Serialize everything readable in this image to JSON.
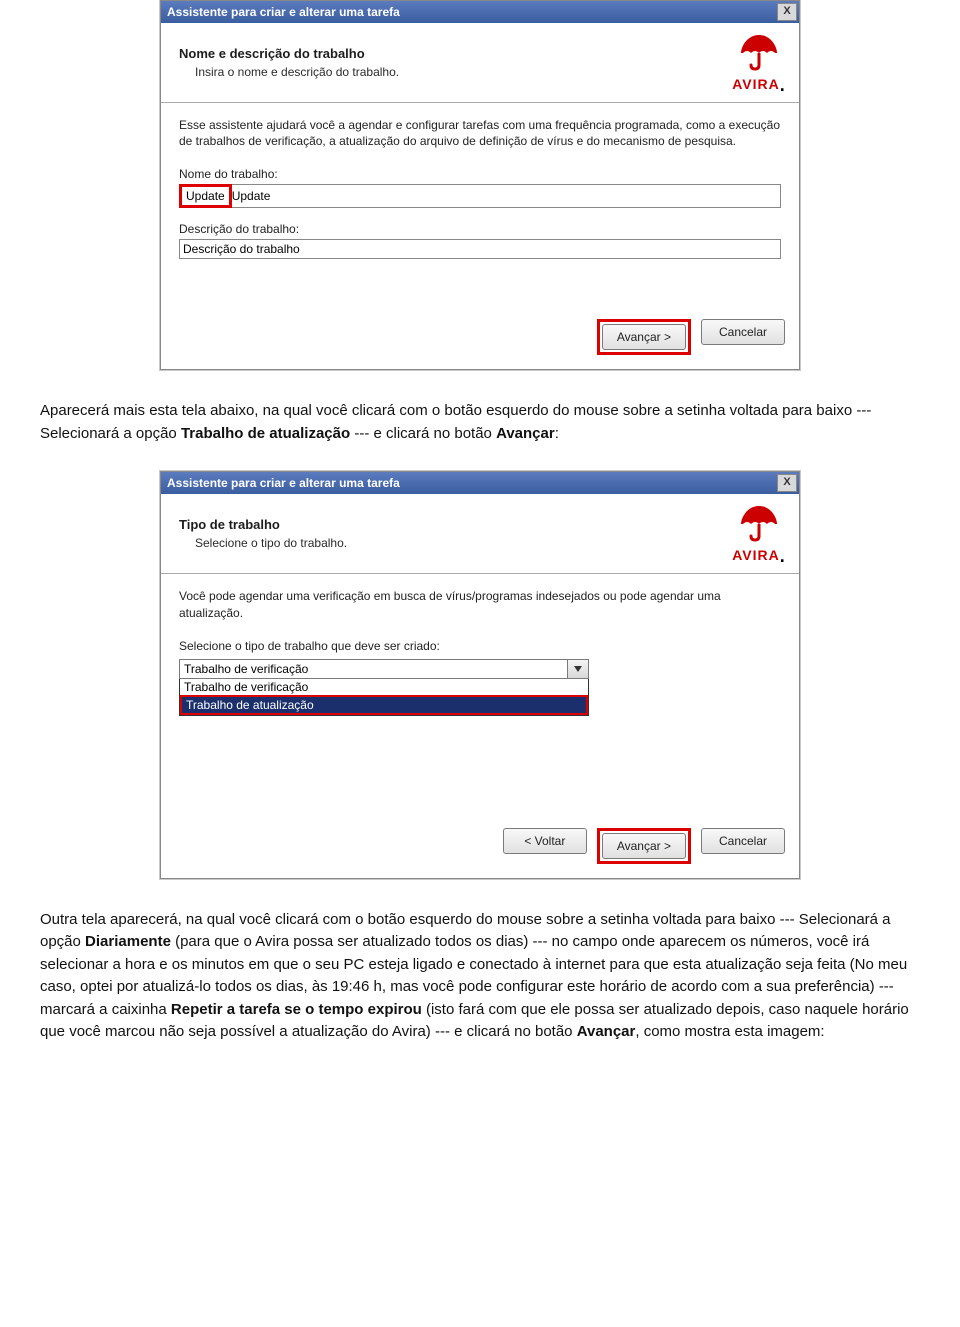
{
  "dialog1": {
    "title": "Assistente para criar e alterar uma tarefa",
    "headerTitle": "Nome e descrição do trabalho",
    "headerSub": "Insira o nome e descrição do trabalho.",
    "brand": "AVIRA",
    "intro": "Esse assistente ajudará você a agendar e configurar tarefas com uma frequência programada, como a execução de trabalhos de verificação, a atualização do arquivo de definição de vírus e do mecanismo de pesquisa.",
    "nameLabel": "Nome do trabalho:",
    "nameValue": "Update",
    "descLabel": "Descrição do trabalho:",
    "descValue": "Descrição do trabalho",
    "advance": "Avançar >",
    "cancel": "Cancelar",
    "closeX": "X"
  },
  "para1": {
    "t0": "Aparecerá mais esta tela abaixo, na qual você clicará com o botão esquerdo do mouse sobre a setinha voltada para baixo --- Selecionará a opção ",
    "b1": "Trabalho de atualização",
    "t2": " --- e clicará no botão ",
    "b3": "Avançar",
    "t4": ":"
  },
  "dialog2": {
    "title": "Assistente para criar e alterar uma tarefa",
    "headerTitle": "Tipo de trabalho",
    "headerSub": "Selecione o tipo do trabalho.",
    "brand": "AVIRA",
    "intro": "Você pode agendar uma verificação em busca de vírus/programas indesejados ou pode agendar uma atualização.",
    "selectLabel": "Selecione o tipo de trabalho que deve ser criado:",
    "comboValue": "Trabalho de verificação",
    "opt1": "Trabalho de verificação",
    "opt2": "Trabalho de atualização",
    "back": "< Voltar",
    "advance": "Avançar >",
    "cancel": "Cancelar",
    "closeX": "X"
  },
  "para2": {
    "t0": "Outra tela aparecerá, na qual você clicará com o botão esquerdo do mouse sobre a setinha voltada para baixo --- Selecionará a opção ",
    "b1": "Diariamente",
    "t2": " (para que o Avira possa ser atualizado todos os dias) --- no campo onde aparecem os números, você irá selecionar a hora e os minutos em que o seu PC esteja ligado e conectado à internet para que esta atualização seja feita (No meu caso, optei por atualizá-lo todos os dias, às 19:46 h, mas você pode configurar este horário de acordo com a sua preferência) --- marcará a caixinha ",
    "b3": "Repetir a tarefa se o tempo expirou",
    "t4": " (isto fará com que ele possa ser atualizado depois, caso naquele horário que você marcou não seja possível a atualização do Avira) --- e clicará no botão ",
    "b5": "Avançar",
    "t6": ", como mostra esta imagem:"
  }
}
